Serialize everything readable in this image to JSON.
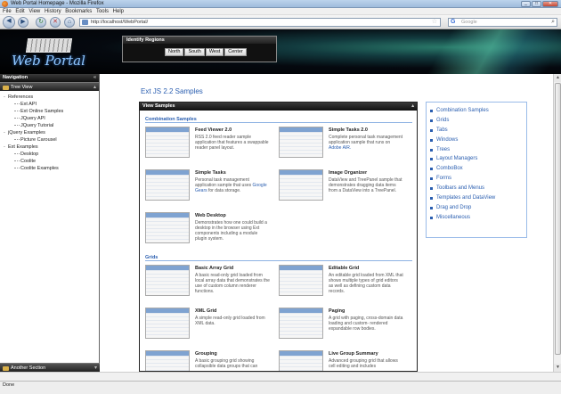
{
  "window": {
    "title": "Web Portal Homepage - Mozilla Firefox"
  },
  "menu": [
    "File",
    "Edit",
    "View",
    "History",
    "Bookmarks",
    "Tools",
    "Help"
  ],
  "browser": {
    "url": "http://localhost/WebPortal/",
    "search_engine": "Google",
    "status": "Done"
  },
  "header": {
    "logo_text": "Web Portal",
    "region_panel": {
      "title": "Identify Regions",
      "buttons": [
        "North",
        "South",
        "West",
        "Center"
      ]
    }
  },
  "sidebar": {
    "title": "Navigation",
    "tree_view_label": "Tree View",
    "tree": [
      {
        "label": "References",
        "level": 0,
        "expander": "-"
      },
      {
        "label": "Ext API",
        "level": 1
      },
      {
        "label": "Ext Online Samples",
        "level": 1
      },
      {
        "label": "JQuery API",
        "level": 1
      },
      {
        "label": "JQuery Tutorial",
        "level": 1
      },
      {
        "label": "jQuery Examples",
        "level": 0,
        "expander": "-"
      },
      {
        "label": "Picture Carousel",
        "level": 1
      },
      {
        "label": "Ext Examples",
        "level": 0,
        "expander": "-"
      },
      {
        "label": "Desktop",
        "level": 1
      },
      {
        "label": "Coolite",
        "level": 1
      },
      {
        "label": "Coolite Examples",
        "level": 1
      }
    ],
    "another_section_label": "Another Section"
  },
  "content": {
    "page_title": "Ext JS 2.2 Samples",
    "samples_panel_title": "View Samples",
    "groups": [
      {
        "title": "Combination Samples",
        "items": [
          {
            "name": "Feed Viewer 2.0",
            "desc": "RSS 2.0 feed reader sample application that features a swappable reader panel layout."
          },
          {
            "name": "Simple Tasks 2.0",
            "desc": "Complete personal task management application sample that runs on",
            "link": "Adobe AIR."
          },
          {
            "name": "Simple Tasks",
            "desc": "Personal task management application sample that uses",
            "link": "Google Gears",
            "desc2": "for data storage."
          },
          {
            "name": "Image Organizer",
            "desc": "DataView and TreePanel sample that demonstrates dragging data items from a DataView into a TreePanel."
          },
          {
            "name": "Web Desktop",
            "desc": "Demonstrates how one could build a desktop in the browser using Ext components including a module plugin system."
          }
        ]
      },
      {
        "title": "Grids",
        "items": [
          {
            "name": "Basic Array Grid",
            "desc": "A basic read-only grid loaded from local array data that demonstrates the use of custom column renderer functions."
          },
          {
            "name": "Editable Grid",
            "desc": "An editable grid loaded from XML that shows multiple types of grid editors as well as defining custom data records."
          },
          {
            "name": "XML Grid",
            "desc": "A simple read-only grid loaded from XML data."
          },
          {
            "name": "Paging",
            "desc": "A grid with paging, cross-domain data loading and custom- rendered expandable row bodies."
          },
          {
            "name": "Grouping",
            "desc": "A basic grouping grid showing collapsible data groups that can"
          },
          {
            "name": "Live Group Summary",
            "desc": "Advanced grouping grid that allows cell editing and includes"
          }
        ]
      }
    ],
    "categories": [
      "Combination Samples",
      "Grids",
      "Tabs",
      "Windows",
      "Trees",
      "Layout Managers",
      "ComboBox",
      "Forms",
      "Toolbars and Menus",
      "Templates and DataView",
      "Drag and Drop",
      "Miscellaneous"
    ]
  },
  "colors": {
    "link": "#2a5eb0",
    "header_bg": "#000000",
    "panel_header": "#1a1a1a"
  }
}
